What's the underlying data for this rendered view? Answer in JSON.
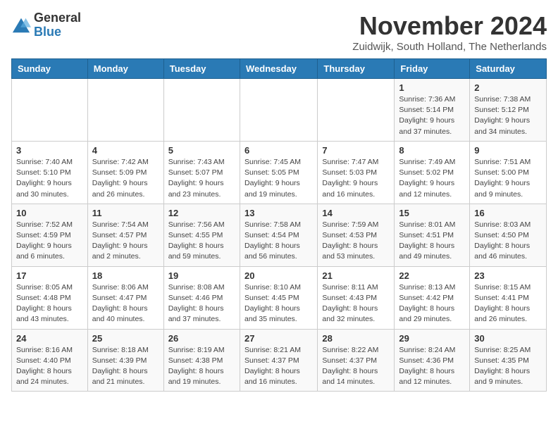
{
  "logo": {
    "general": "General",
    "blue": "Blue"
  },
  "title": "November 2024",
  "subtitle": "Zuidwijk, South Holland, The Netherlands",
  "weekdays": [
    "Sunday",
    "Monday",
    "Tuesday",
    "Wednesday",
    "Thursday",
    "Friday",
    "Saturday"
  ],
  "weeks": [
    [
      {
        "day": "",
        "info": ""
      },
      {
        "day": "",
        "info": ""
      },
      {
        "day": "",
        "info": ""
      },
      {
        "day": "",
        "info": ""
      },
      {
        "day": "",
        "info": ""
      },
      {
        "day": "1",
        "info": "Sunrise: 7:36 AM\nSunset: 5:14 PM\nDaylight: 9 hours and 37 minutes."
      },
      {
        "day": "2",
        "info": "Sunrise: 7:38 AM\nSunset: 5:12 PM\nDaylight: 9 hours and 34 minutes."
      }
    ],
    [
      {
        "day": "3",
        "info": "Sunrise: 7:40 AM\nSunset: 5:10 PM\nDaylight: 9 hours and 30 minutes."
      },
      {
        "day": "4",
        "info": "Sunrise: 7:42 AM\nSunset: 5:09 PM\nDaylight: 9 hours and 26 minutes."
      },
      {
        "day": "5",
        "info": "Sunrise: 7:43 AM\nSunset: 5:07 PM\nDaylight: 9 hours and 23 minutes."
      },
      {
        "day": "6",
        "info": "Sunrise: 7:45 AM\nSunset: 5:05 PM\nDaylight: 9 hours and 19 minutes."
      },
      {
        "day": "7",
        "info": "Sunrise: 7:47 AM\nSunset: 5:03 PM\nDaylight: 9 hours and 16 minutes."
      },
      {
        "day": "8",
        "info": "Sunrise: 7:49 AM\nSunset: 5:02 PM\nDaylight: 9 hours and 12 minutes."
      },
      {
        "day": "9",
        "info": "Sunrise: 7:51 AM\nSunset: 5:00 PM\nDaylight: 9 hours and 9 minutes."
      }
    ],
    [
      {
        "day": "10",
        "info": "Sunrise: 7:52 AM\nSunset: 4:59 PM\nDaylight: 9 hours and 6 minutes."
      },
      {
        "day": "11",
        "info": "Sunrise: 7:54 AM\nSunset: 4:57 PM\nDaylight: 9 hours and 2 minutes."
      },
      {
        "day": "12",
        "info": "Sunrise: 7:56 AM\nSunset: 4:55 PM\nDaylight: 8 hours and 59 minutes."
      },
      {
        "day": "13",
        "info": "Sunrise: 7:58 AM\nSunset: 4:54 PM\nDaylight: 8 hours and 56 minutes."
      },
      {
        "day": "14",
        "info": "Sunrise: 7:59 AM\nSunset: 4:53 PM\nDaylight: 8 hours and 53 minutes."
      },
      {
        "day": "15",
        "info": "Sunrise: 8:01 AM\nSunset: 4:51 PM\nDaylight: 8 hours and 49 minutes."
      },
      {
        "day": "16",
        "info": "Sunrise: 8:03 AM\nSunset: 4:50 PM\nDaylight: 8 hours and 46 minutes."
      }
    ],
    [
      {
        "day": "17",
        "info": "Sunrise: 8:05 AM\nSunset: 4:48 PM\nDaylight: 8 hours and 43 minutes."
      },
      {
        "day": "18",
        "info": "Sunrise: 8:06 AM\nSunset: 4:47 PM\nDaylight: 8 hours and 40 minutes."
      },
      {
        "day": "19",
        "info": "Sunrise: 8:08 AM\nSunset: 4:46 PM\nDaylight: 8 hours and 37 minutes."
      },
      {
        "day": "20",
        "info": "Sunrise: 8:10 AM\nSunset: 4:45 PM\nDaylight: 8 hours and 35 minutes."
      },
      {
        "day": "21",
        "info": "Sunrise: 8:11 AM\nSunset: 4:43 PM\nDaylight: 8 hours and 32 minutes."
      },
      {
        "day": "22",
        "info": "Sunrise: 8:13 AM\nSunset: 4:42 PM\nDaylight: 8 hours and 29 minutes."
      },
      {
        "day": "23",
        "info": "Sunrise: 8:15 AM\nSunset: 4:41 PM\nDaylight: 8 hours and 26 minutes."
      }
    ],
    [
      {
        "day": "24",
        "info": "Sunrise: 8:16 AM\nSunset: 4:40 PM\nDaylight: 8 hours and 24 minutes."
      },
      {
        "day": "25",
        "info": "Sunrise: 8:18 AM\nSunset: 4:39 PM\nDaylight: 8 hours and 21 minutes."
      },
      {
        "day": "26",
        "info": "Sunrise: 8:19 AM\nSunset: 4:38 PM\nDaylight: 8 hours and 19 minutes."
      },
      {
        "day": "27",
        "info": "Sunrise: 8:21 AM\nSunset: 4:37 PM\nDaylight: 8 hours and 16 minutes."
      },
      {
        "day": "28",
        "info": "Sunrise: 8:22 AM\nSunset: 4:37 PM\nDaylight: 8 hours and 14 minutes."
      },
      {
        "day": "29",
        "info": "Sunrise: 8:24 AM\nSunset: 4:36 PM\nDaylight: 8 hours and 12 minutes."
      },
      {
        "day": "30",
        "info": "Sunrise: 8:25 AM\nSunset: 4:35 PM\nDaylight: 8 hours and 9 minutes."
      }
    ]
  ]
}
